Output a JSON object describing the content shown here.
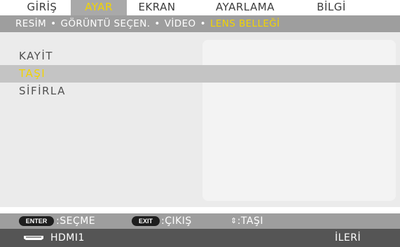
{
  "tabs": [
    {
      "label": "GİRİŞ",
      "active": false
    },
    {
      "label": "AYAR",
      "active": true
    },
    {
      "label": "EKRAN",
      "active": false
    },
    {
      "label": "AYARLAMA",
      "active": false
    },
    {
      "label": "BİLGİ",
      "active": false
    }
  ],
  "submenu": [
    {
      "label": "RESİM",
      "active": false
    },
    {
      "label": "GÖRÜNTÜ SEÇEN.",
      "active": false
    },
    {
      "label": "VİDEO",
      "active": false
    },
    {
      "label": "LENS BELLEĞİ",
      "active": true
    }
  ],
  "menu_items": [
    {
      "label": "KAYİT",
      "selected": false
    },
    {
      "label": "TAŞI",
      "selected": true
    },
    {
      "label": "SİFİRLA",
      "selected": false
    }
  ],
  "help": {
    "enter_key": "ENTER",
    "enter_label": ":SEÇME",
    "exit_key": "EXIT",
    "exit_label": ":ÇIKIŞ",
    "move_icon": "up-down-arrows-icon",
    "move_label": ":TAŞI"
  },
  "status": {
    "source_icon": "hdmi-connector-icon",
    "source": "HDMI1",
    "right": "İLERİ"
  },
  "colors": {
    "active_text": "#f2d400",
    "active_tab_bg": "#a9a9a9",
    "submenu_bg": "#9e9e9e",
    "content_bg": "#ebebeb",
    "selected_row_bg": "#c4c4c4",
    "status_bg": "#555555"
  }
}
